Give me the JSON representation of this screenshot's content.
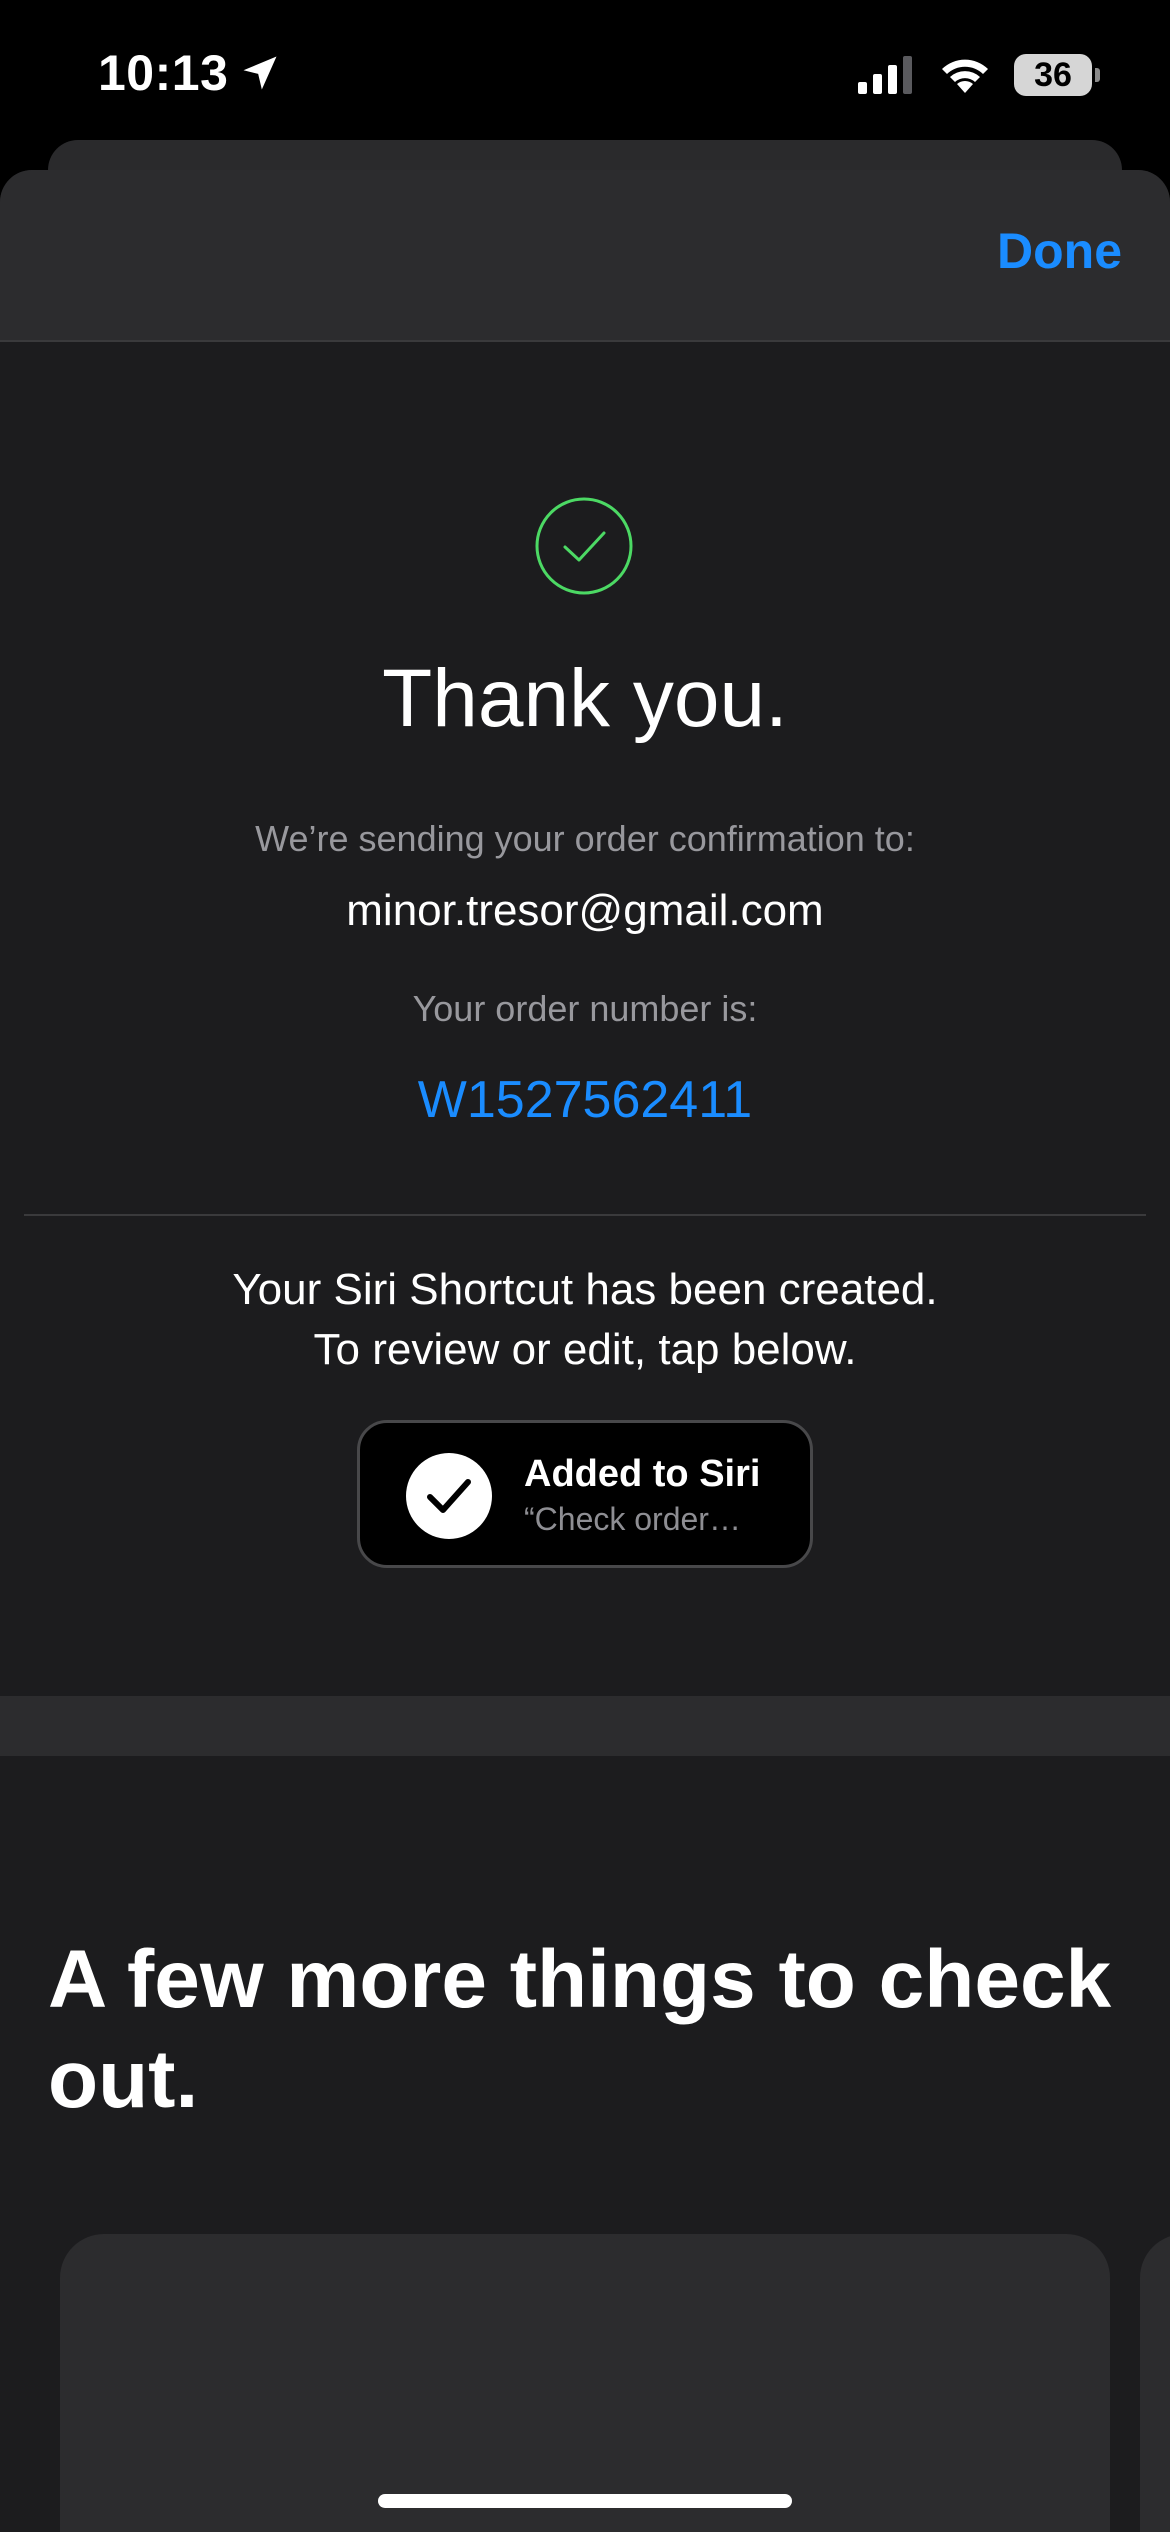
{
  "status_bar": {
    "time": "10:13",
    "battery": "36"
  },
  "header": {
    "done_label": "Done"
  },
  "confirmation": {
    "title": "Thank you.",
    "sending_label": "We’re sending your order confirmation to:",
    "email": "minor.tresor@gmail.com",
    "order_number_label": "Your order number is:",
    "order_number": "W1527562411",
    "check_color": "#4cd964"
  },
  "siri": {
    "line1": "Your Siri Shortcut has been created.",
    "line2": "To review or edit, tap below.",
    "button_title": "Added to Siri",
    "button_subtitle": "“Check order…"
  },
  "more": {
    "title": "A few more things to check out."
  },
  "colors": {
    "accent": "#1a8cff",
    "background": "#1c1c1e"
  }
}
